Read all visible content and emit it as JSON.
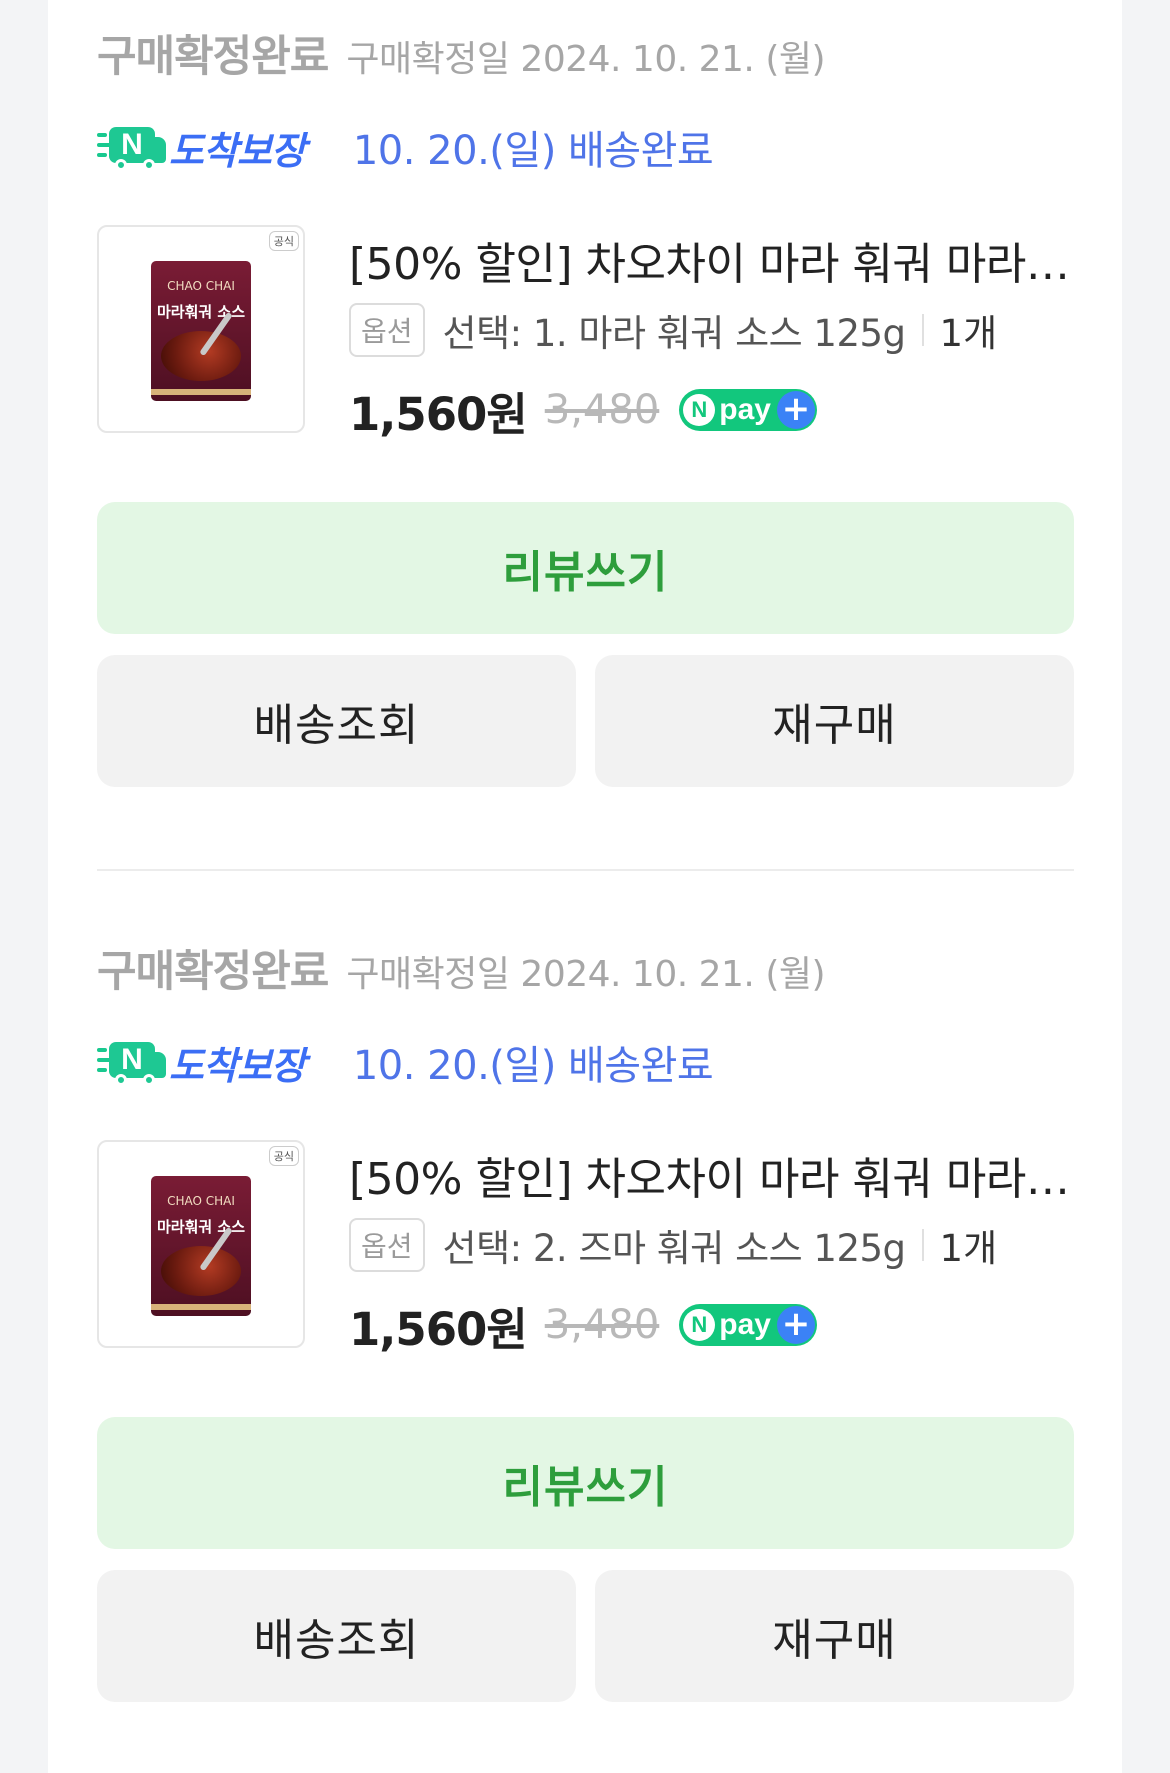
{
  "orders": [
    {
      "status_title": "구매확정완료",
      "confirm_date": "구매확정일 2024. 10. 21. (월)",
      "guarantee_badge": "N",
      "guarantee_label": "도착보장",
      "delivery_status": "10. 20.(일) 배송완료",
      "thumbnail": {
        "official_badge": "공식",
        "brand": "CHAO CHAI",
        "name": "마라훠궈 소스"
      },
      "product_title": "[50% 할인] 차오차이 마라 훠궈 마라…",
      "option_tag": "옵션",
      "option_text": "선택: 1. 마라 훠궈 소스 125g",
      "quantity": "1개",
      "price": "1,560원",
      "original_price": "3,480",
      "npay": {
        "n": "N",
        "pay": "pay",
        "plus": "+"
      },
      "review_button": "리뷰쓰기",
      "track_button": "배송조회",
      "rebuy_button": "재구매"
    },
    {
      "status_title": "구매확정완료",
      "confirm_date": "구매확정일 2024. 10. 21. (월)",
      "guarantee_badge": "N",
      "guarantee_label": "도착보장",
      "delivery_status": "10. 20.(일) 배송완료",
      "thumbnail": {
        "official_badge": "공식",
        "brand": "CHAO CHAI",
        "name": "마라훠궈 소스"
      },
      "product_title": "[50% 할인] 차오차이 마라 훠궈 마라…",
      "option_tag": "옵션",
      "option_text": "선택: 2. 즈마 훠궈 소스 125g",
      "quantity": "1개",
      "price": "1,560원",
      "original_price": "3,480",
      "npay": {
        "n": "N",
        "pay": "pay",
        "plus": "+"
      },
      "review_button": "리뷰쓰기",
      "track_button": "배송조회",
      "rebuy_button": "재구매"
    }
  ],
  "colors": {
    "status_gray": "#a6a6a6",
    "delivery_blue": "#4f74e8",
    "guarantee_green": "#1ec893",
    "review_bg": "#e3f7e4",
    "review_text": "#2e9e3c",
    "npay_green": "#12c77d"
  }
}
